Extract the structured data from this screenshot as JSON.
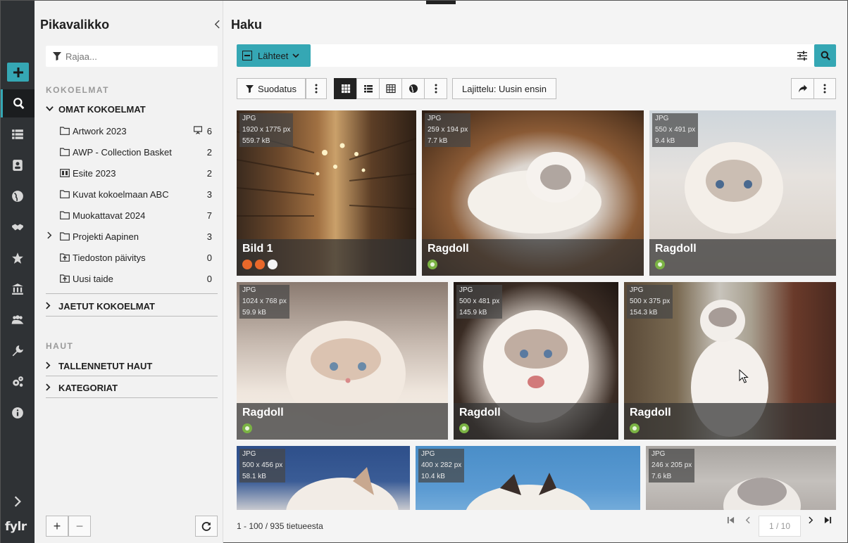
{
  "app": {
    "logo": "fylr"
  },
  "rail": {
    "items": [
      {
        "name": "add",
        "icon": "plus-icon"
      },
      {
        "name": "search",
        "icon": "search-icon",
        "active": true
      },
      {
        "name": "list",
        "icon": "list-icon"
      },
      {
        "name": "contacts",
        "icon": "contact-card-icon"
      },
      {
        "name": "globe",
        "icon": "globe-icon"
      },
      {
        "name": "handshake",
        "icon": "handshake-icon"
      },
      {
        "name": "favorites",
        "icon": "star-icon"
      },
      {
        "name": "institution",
        "icon": "bank-icon"
      },
      {
        "name": "users",
        "icon": "users-icon"
      },
      {
        "name": "tools",
        "icon": "wrench-icon"
      },
      {
        "name": "settings",
        "icon": "gears-icon"
      },
      {
        "name": "info",
        "icon": "info-icon"
      }
    ],
    "expand_icon": "chevron-right-icon"
  },
  "sidebar": {
    "title": "Pikavalikko",
    "filter_placeholder": "Rajaa...",
    "collections_section": "KOKOELMAT",
    "own_collections": "OMAT KOKOELMAT",
    "items": [
      {
        "label": "Artwork 2023",
        "count": "6",
        "icon": "folder-icon",
        "shared": true
      },
      {
        "label": "AWP - Collection Basket",
        "count": "2",
        "icon": "folder-icon"
      },
      {
        "label": "Esite 2023",
        "count": "2",
        "icon": "presentation-icon"
      },
      {
        "label": "Kuvat kokoelmaan ABC",
        "count": "3",
        "icon": "folder-icon"
      },
      {
        "label": "Muokattavat 2024",
        "count": "7",
        "icon": "folder-icon"
      },
      {
        "label": "Projekti Aapinen",
        "count": "3",
        "icon": "folder-icon",
        "expandable": true
      },
      {
        "label": "Tiedoston päivitys",
        "count": "0",
        "icon": "upload-folder-icon"
      },
      {
        "label": "Uusi taide",
        "count": "0",
        "icon": "upload-folder-icon"
      }
    ],
    "shared_collections": "JAETUT KOKOELMAT",
    "searches_section": "HAUT",
    "saved_searches": "TALLENNETUT HAUT",
    "categories": "KATEGORIAT",
    "add_btn": "+",
    "remove_btn": "−"
  },
  "main": {
    "title": "Haku",
    "sources_btn": "Lähteet",
    "filter_btn": "Suodatus",
    "sort_btn": "Lajittelu: Uusin ensin",
    "result_count": "1 - 100 / 935 tietueesta",
    "page_indicator": "1 / 10"
  },
  "tiles": [
    {
      "title": "Bild 1",
      "format": "JPG",
      "dims": "1920 x 1775 px",
      "size": "559.7 kB",
      "badges": [
        "orange",
        "orange",
        "white"
      ]
    },
    {
      "title": "Ragdoll",
      "format": "JPG",
      "dims": "259 x 194 px",
      "size": "7.7 kB",
      "badges": [
        "green"
      ]
    },
    {
      "title": "Ragdoll",
      "format": "JPG",
      "dims": "550 x 491 px",
      "size": "9.4 kB",
      "badges": [
        "green"
      ]
    },
    {
      "title": "Ragdoll",
      "format": "JPG",
      "dims": "1024 x 768 px",
      "size": "59.9 kB",
      "badges": [
        "green"
      ]
    },
    {
      "title": "Ragdoll",
      "format": "JPG",
      "dims": "500 x 481 px",
      "size": "145.9 kB",
      "badges": [
        "green"
      ]
    },
    {
      "title": "Ragdoll",
      "format": "JPG",
      "dims": "500 x 375 px",
      "size": "154.3 kB",
      "badges": [
        "green"
      ]
    },
    {
      "title": "",
      "format": "JPG",
      "dims": "500 x 456 px",
      "size": "58.1 kB",
      "badges": []
    },
    {
      "title": "",
      "format": "JPG",
      "dims": "400 x 282 px",
      "size": "10.4 kB",
      "badges": []
    },
    {
      "title": "",
      "format": "JPG",
      "dims": "246 x 205 px",
      "size": "7.6 kB",
      "badges": []
    }
  ],
  "colors": {
    "accent": "#35a7b4",
    "rail_bg": "#2f3235",
    "badge_green": "#7bb344",
    "badge_orange": "#e9682a"
  }
}
